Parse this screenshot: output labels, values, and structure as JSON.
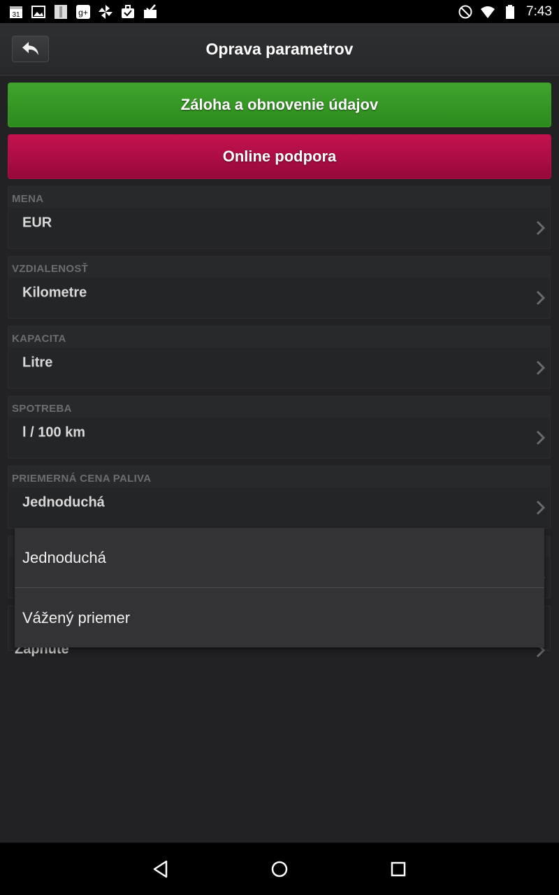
{
  "status_bar": {
    "time": "7:43",
    "left_icons": [
      "calendar-icon",
      "gallery-icon",
      "book-icon",
      "google-plus-icon",
      "pinwheel-icon",
      "briefcase-check-icon",
      "inbox-check-icon"
    ],
    "calendar_day": "31",
    "right_icons": [
      "do-not-disturb-icon",
      "wifi-icon",
      "battery-icon"
    ]
  },
  "header": {
    "title": "Oprava parametrov",
    "back_icon": "back-arrow-icon"
  },
  "buttons": {
    "backup_label": "Záloha a obnovenie údajov",
    "support_label": "Online podpora"
  },
  "settings": [
    {
      "header": "MENA",
      "value": "EUR"
    },
    {
      "header": "VZDIALENOSŤ",
      "value": "Kilometre"
    },
    {
      "header": "KAPACITA",
      "value": "Litre"
    },
    {
      "header": "SPOTREBA",
      "value": "l / 100 km"
    },
    {
      "header": "PRIEMERNÁ CENA PALIVA",
      "value": "Jednoduchá"
    },
    {
      "header": "",
      "value": "Zapnuté"
    }
  ],
  "dropdown": {
    "options": [
      "Jednoduchá",
      "Vážený priemer"
    ]
  },
  "colors": {
    "backup_green": "#3fa42c",
    "support_crimson": "#c4124f",
    "background": "#222224"
  }
}
